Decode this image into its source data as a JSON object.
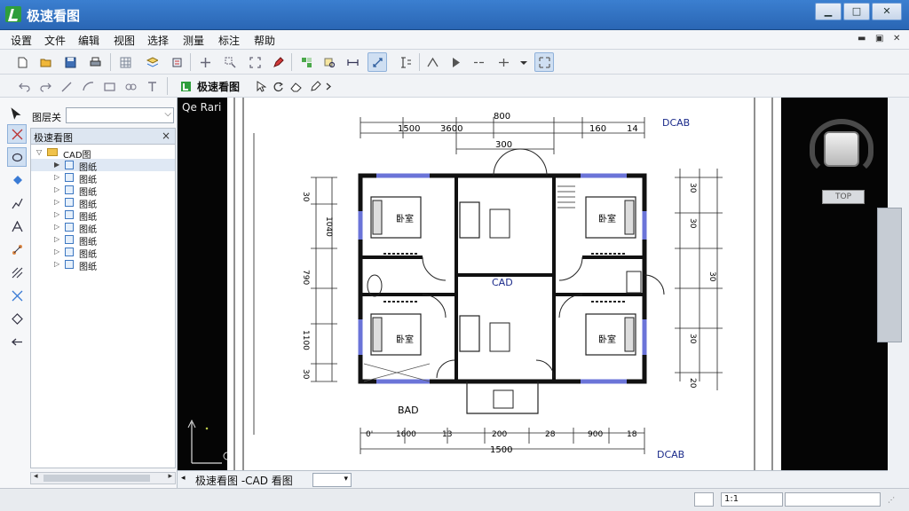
{
  "window": {
    "title": "极速看图"
  },
  "menu": [
    "设置",
    "文件",
    "编辑",
    "视图",
    "选择",
    "测量",
    "标注",
    "帮助"
  ],
  "toolbar2": {
    "brand_label": "极速看图"
  },
  "left_panel": {
    "layer_label": "图层关",
    "tree_title": "极速看图",
    "root_label": "CAD图",
    "items": [
      "图纸",
      "图纸",
      "图纸",
      "图纸",
      "图纸",
      "图纸",
      "图纸",
      "图纸",
      "图纸"
    ]
  },
  "canvas": {
    "dark_label": "Qe Rari",
    "plan_center_label": "CAD",
    "top_right_label": "DCAB",
    "bottom_right_label": "DCAB",
    "bottom_label": "BAD",
    "room_label": "卧室",
    "dims_top_row1": [
      "800"
    ],
    "dims_top_row2": [
      "1500",
      "3600",
      "160",
      "14"
    ],
    "dims_top_row3": [
      "300"
    ],
    "dims_bottom_row1": [
      "0'",
      "1600",
      "13",
      "200",
      "28",
      "900",
      "18"
    ],
    "dims_bottom_row2": [
      "1500"
    ],
    "dims_left": [
      "30",
      "1040",
      "790",
      "1100",
      "30"
    ],
    "dims_right": [
      "30",
      "30",
      "30",
      "30",
      "20"
    ],
    "cube_label": "TOP"
  },
  "tabbar": {
    "tab_label": "极速看图 -CAD 看图"
  },
  "status": {
    "box2": "1:1"
  }
}
